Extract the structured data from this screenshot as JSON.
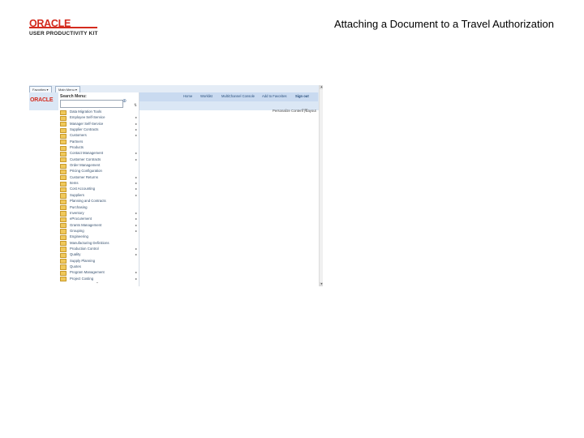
{
  "header": {
    "logo_text": "ORACLE",
    "product_text": "USER PRODUCTIVITY KIT",
    "doc_title": "Attaching a Document to a Travel Authorization"
  },
  "screenshot": {
    "tabs": [
      "Favorites ▾",
      "Main Menu ▾"
    ],
    "logo_text": "ORACLE",
    "top_links": [
      "Home",
      "Worklist",
      "MultiChannel Console",
      "Add to Favorites",
      "Sign out"
    ],
    "personalize_label": "Personalize Content | Layout",
    "personalize_icons": "?  ⊟",
    "menu": {
      "heading": "Search Menu:",
      "search_value": "",
      "go_icon": "search-go-icon",
      "sort_glyph": "⇅",
      "bottom_glyph": "⌄",
      "items": [
        {
          "label": "Data Migration Tools",
          "arrow": ""
        },
        {
          "label": "Employee Self-Service",
          "arrow": "▸"
        },
        {
          "label": "Manager Self-Service",
          "arrow": "▸"
        },
        {
          "label": "Supplier Contracts",
          "arrow": "▸"
        },
        {
          "label": "Customers",
          "arrow": "▸"
        },
        {
          "label": "Partners",
          "arrow": ""
        },
        {
          "label": "Products",
          "arrow": ""
        },
        {
          "label": "Contact Management",
          "arrow": "▸"
        },
        {
          "label": "Customer Contracts",
          "arrow": "▸"
        },
        {
          "label": "Order Management",
          "arrow": ""
        },
        {
          "label": "Pricing Configuration",
          "arrow": ""
        },
        {
          "label": "Customer Returns",
          "arrow": "▸"
        },
        {
          "label": "Items",
          "arrow": "▸"
        },
        {
          "label": "Cost Accounting",
          "arrow": "▸"
        },
        {
          "label": "Suppliers",
          "arrow": "▸"
        },
        {
          "label": "Planning and Contracts",
          "arrow": ""
        },
        {
          "label": "Purchasing",
          "arrow": ""
        },
        {
          "label": "Inventory",
          "arrow": "▸"
        },
        {
          "label": "eProcurement",
          "arrow": "▸"
        },
        {
          "label": "Grants Management",
          "arrow": "▸"
        },
        {
          "label": "Grouping",
          "arrow": "▸"
        },
        {
          "label": "Engineering",
          "arrow": ""
        },
        {
          "label": "Manufacturing Definitions",
          "arrow": ""
        },
        {
          "label": "Production Control",
          "arrow": "▸"
        },
        {
          "label": "Quality",
          "arrow": "▸"
        },
        {
          "label": "Supply Planning",
          "arrow": ""
        },
        {
          "label": "Quotes",
          "arrow": ""
        },
        {
          "label": "Program Management",
          "arrow": "▸"
        },
        {
          "label": "Project Costing",
          "arrow": "▸"
        }
      ]
    }
  },
  "colors": {
    "brand_red": "#d42b1e",
    "header_blue": "#dbe7f5",
    "link_blue": "#2a4f7c",
    "folder_yellow": "#f0c85a"
  }
}
